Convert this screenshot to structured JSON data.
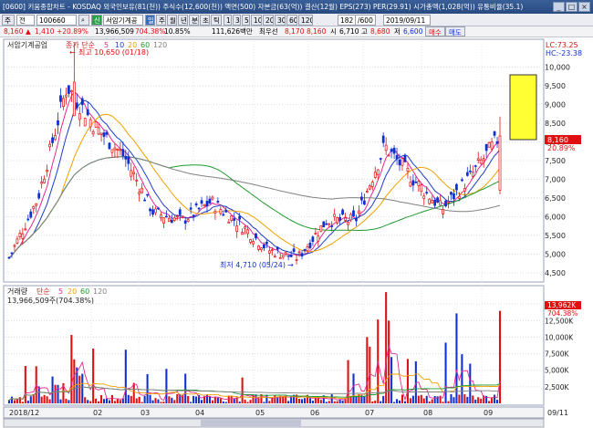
{
  "title_bar": {
    "text": "[0600] 키움종합차트 - KOSDAQ 외국인보유(81(천)) 주식수(12,600(천)) 액면(500) 자본금(63(억)) 결산(12월) EPS(273) PER(29.91) 시가총액(1,028(억)) 유통비율(35.1)",
    "buttons": [
      "_",
      "□",
      "×"
    ]
  },
  "toolbar": {
    "menu": "주",
    "market": "전",
    "code": "100660",
    "search_icon": "magnifier-icon",
    "flag": "신",
    "stock_name": "서암기계공",
    "periods": [
      "일",
      "주",
      "월",
      "년",
      "분",
      "초",
      "틱"
    ],
    "active_period": "일",
    "minutes": [
      "1",
      "3",
      "5",
      "10",
      "20",
      "30",
      "60",
      "120"
    ],
    "count": "182",
    "count_total": "/600",
    "date": "2019/09/11"
  },
  "info_bar": {
    "price": "8,160",
    "change_arrow": "▲",
    "change": "1,410",
    "change_pct": "+20.89%",
    "volume": "13,966,509",
    "volume_ratio": "704.38%",
    "turnover": "10.85%",
    "period_high_low": "111,626백만",
    "high_label": "최우선",
    "open": "8,170",
    "low_price": "8,160",
    "open_label": "시",
    "open_val": "6,710",
    "high_label2": "고",
    "high_val": "8,680",
    "low_label": "저",
    "low_val": "6,600",
    "buy_btn": "매수",
    "sell_btn": "매도"
  },
  "price_panel": {
    "stock_label": "서암기계공업",
    "ma_label": "종가 단순",
    "ma_periods": [
      "5",
      "10",
      "20",
      "60",
      "120"
    ],
    "ma_colors": [
      "#e8278f",
      "#1f3cc8",
      "#f0a000",
      "#1e9a30",
      "#808080"
    ],
    "lc": "LC:73.25",
    "hc": "HC:-23.38",
    "high_annotation": "최고 10,650 (01/18)",
    "low_annotation": "최저 4,710 (05/24)",
    "current_price": "8,160",
    "current_pct": "20.89%",
    "axis_ticks": [
      "10,000",
      "9,500",
      "9,000",
      "8,500",
      "8,000",
      "7,500",
      "7,000",
      "6,500",
      "6,000",
      "5,500",
      "5,000",
      "4,500"
    ]
  },
  "volume_panel": {
    "label": "거래량",
    "ma_label": "단순",
    "ma_periods": [
      "5",
      "20",
      "60",
      "120"
    ],
    "ma_colors": [
      "#e8278f",
      "#f0a000",
      "#1e9a30",
      "#808080"
    ],
    "value_line": "13,966,509주(704.38%)",
    "current": "13,962K",
    "current_pct": "704.38%",
    "axis_ticks": [
      "15,000K",
      "12,500K",
      "10,000K",
      "7,500K",
      "5,000K",
      "2,500K"
    ]
  },
  "x_axis": {
    "labels": [
      "2018/12",
      "02",
      "03",
      "04",
      "05",
      "06",
      "07",
      "08",
      "09"
    ],
    "right_label": "09/11"
  },
  "chart_data": {
    "type": "candlestick",
    "price_range": [
      4300,
      10700
    ],
    "volume_range": [
      0,
      17500000
    ],
    "candles_weekly_approx": [
      {
        "date": "2018/12",
        "open": 5100,
        "high": 5350,
        "low": 4700,
        "close": 4900
      },
      {
        "date": "2019/01a",
        "open": 5200,
        "high": 6800,
        "low": 5100,
        "close": 6500
      },
      {
        "date": "2019/01b",
        "open": 7000,
        "high": 10650,
        "low": 6900,
        "close": 9500
      },
      {
        "date": "2019/02a",
        "open": 9200,
        "high": 9500,
        "low": 8100,
        "close": 8400
      },
      {
        "date": "2019/02b",
        "open": 8500,
        "high": 8700,
        "low": 7300,
        "close": 7600
      },
      {
        "date": "2019/03a",
        "open": 7200,
        "high": 7600,
        "low": 5800,
        "close": 6100
      },
      {
        "date": "2019/03b",
        "open": 6000,
        "high": 6200,
        "low": 5800,
        "close": 5900
      },
      {
        "date": "2019/04a",
        "open": 6100,
        "high": 6500,
        "low": 6000,
        "close": 6400
      },
      {
        "date": "2019/04b",
        "open": 6300,
        "high": 6400,
        "low": 5700,
        "close": 5800
      },
      {
        "date": "2019/05a",
        "open": 5600,
        "high": 5700,
        "low": 5000,
        "close": 5100
      },
      {
        "date": "2019/05b",
        "open": 5000,
        "high": 5300,
        "low": 4710,
        "close": 4900
      },
      {
        "date": "2019/06a",
        "open": 5200,
        "high": 6200,
        "low": 5100,
        "close": 5900
      },
      {
        "date": "2019/06b",
        "open": 5800,
        "high": 6100,
        "low": 5600,
        "close": 5900
      },
      {
        "date": "2019/07a",
        "open": 5600,
        "high": 8900,
        "low": 5500,
        "close": 7900
      },
      {
        "date": "2019/07b",
        "open": 7500,
        "high": 8400,
        "low": 6700,
        "close": 7000
      },
      {
        "date": "2019/08a",
        "open": 6700,
        "high": 7000,
        "low": 5800,
        "close": 6200
      },
      {
        "date": "2019/08b",
        "open": 6400,
        "high": 7600,
        "low": 6300,
        "close": 7100
      },
      {
        "date": "2019/09",
        "open": 6710,
        "high": 8680,
        "low": 6600,
        "close": 8160
      }
    ]
  }
}
